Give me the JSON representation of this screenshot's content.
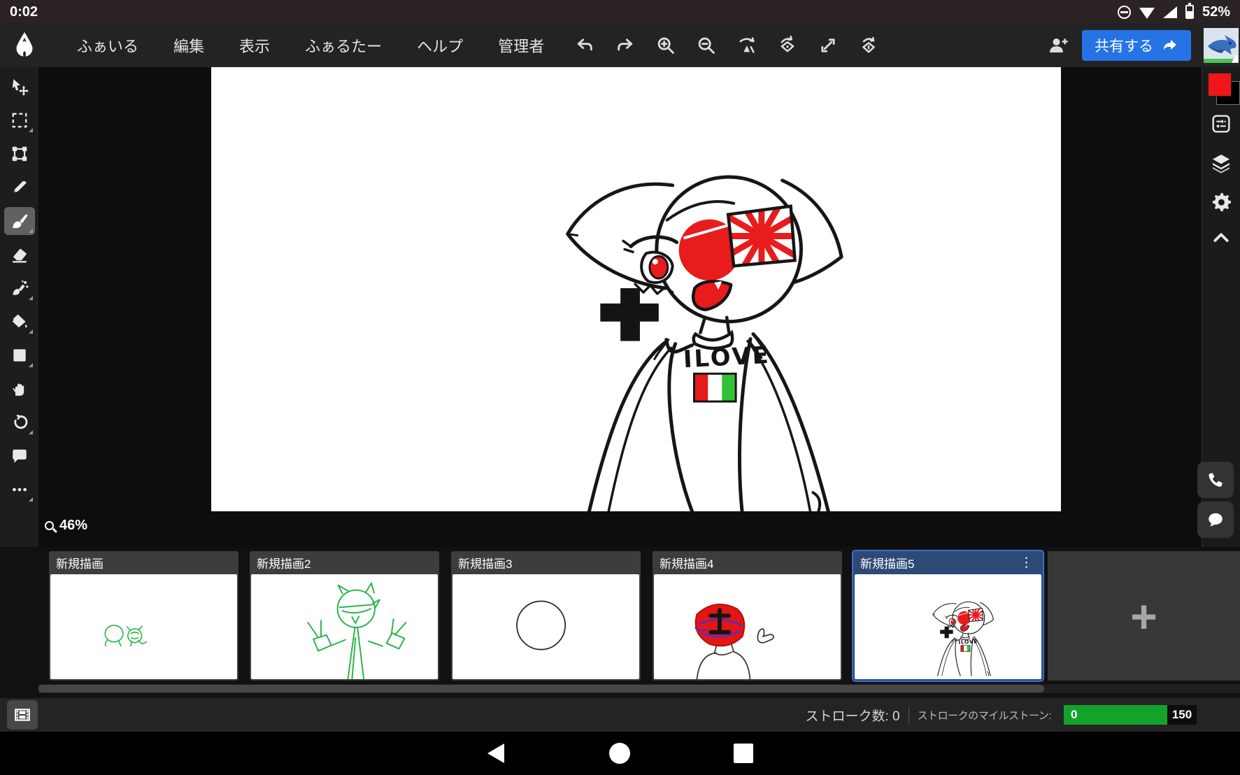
{
  "status_bar": {
    "time": "0:02",
    "battery_percent": "52%"
  },
  "menu_bar": {
    "menus": [
      {
        "label": "ふぁいる"
      },
      {
        "label": "編集"
      },
      {
        "label": "表示"
      },
      {
        "label": "ふぁるたー"
      },
      {
        "label": "ヘルプ"
      },
      {
        "label": "管理者"
      }
    ],
    "actions": [
      "undo",
      "redo",
      "zoom-in",
      "zoom-out",
      "flip",
      "rotate-canvas",
      "fit-screen",
      "reset-rotation"
    ],
    "share_button": {
      "label": "共有する"
    }
  },
  "left_toolbar": {
    "tools": [
      {
        "name": "move"
      },
      {
        "name": "marquee-select",
        "flyout": true
      },
      {
        "name": "transform"
      },
      {
        "name": "pen"
      },
      {
        "name": "brush",
        "selected": true,
        "flyout": true
      },
      {
        "name": "eraser"
      },
      {
        "name": "airbrush",
        "flyout": true
      },
      {
        "name": "fill-bucket",
        "flyout": true
      },
      {
        "name": "shape",
        "flyout": true
      },
      {
        "name": "hand"
      },
      {
        "name": "undo-history",
        "flyout": true
      },
      {
        "name": "chat"
      },
      {
        "name": "more",
        "flyout": true
      }
    ]
  },
  "right_panel": {
    "foreground_color": "#ee1616",
    "background_color": "#000000",
    "buttons": [
      "brush-settings",
      "layers",
      "settings",
      "collapse"
    ],
    "call_buttons": [
      "voice-call",
      "chat"
    ]
  },
  "canvas": {
    "zoom_level": "46%",
    "drawing": {
      "shirt_text": "ILOVE",
      "flag_colors": [
        "#e31b1b",
        "#ffffff",
        "#35c135"
      ]
    }
  },
  "film_strip": {
    "canvases": [
      {
        "title": "新規描画",
        "selected": false
      },
      {
        "title": "新規描画2",
        "selected": false
      },
      {
        "title": "新規描画3",
        "selected": false
      },
      {
        "title": "新規描画4",
        "selected": false
      },
      {
        "title": "新規描画5",
        "selected": true
      }
    ],
    "add_button_label": "+",
    "kebab_icon": "⋮"
  },
  "footer": {
    "stroke_count_label": "ストローク数: 0",
    "milestone_label": "ストロークのマイルストーン:",
    "milestone_value": "0",
    "milestone_max": "150"
  },
  "colors": {
    "accent_blue": "#2673e6",
    "selected_card_border": "#3d6cc8",
    "milestone_green": "#14a32a",
    "status_bar_bg": "#2b2225"
  }
}
